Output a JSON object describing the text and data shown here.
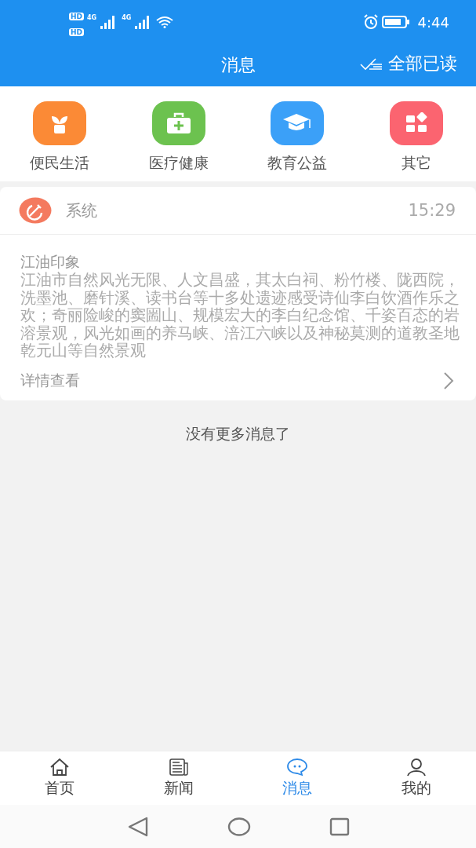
{
  "status_bar": {
    "sim_labels": [
      "HD",
      "HD"
    ],
    "network_labels": [
      "4G",
      "4G"
    ],
    "time": "4:44"
  },
  "header": {
    "title": "消息",
    "action": "全部已读"
  },
  "categories": [
    {
      "label": "便民生活",
      "kind": "plant",
      "color": "#fb8a36"
    },
    {
      "label": "医疗健康",
      "kind": "medkit",
      "color": "#6cc24f"
    },
    {
      "label": "教育公益",
      "kind": "cap",
      "color": "#3ba0f8"
    },
    {
      "label": "其它",
      "kind": "grid",
      "color": "#fb6470"
    }
  ],
  "messages": [
    {
      "sender": "系统",
      "time": "15:29",
      "title": "江油印象",
      "body": "江油市自然风光无限、人文昌盛，其太白祠、粉竹楼、陇西院，洗墨池、磨针溪、读书台等十多处遗迹感受诗仙李白饮酒作乐之欢；奇丽险峻的窦圌山、规模宏大的李白纪念馆、千姿百态的岩溶景观，风光如画的养马峡、涪江六峡以及神秘莫测的道教圣地乾元山等自然景观",
      "link": "详情查看"
    }
  ],
  "end_note": "没有更多消息了",
  "tabs": [
    {
      "label": "首页",
      "kind": "home",
      "selected": false
    },
    {
      "label": "新闻",
      "kind": "news",
      "selected": false
    },
    {
      "label": "消息",
      "kind": "chat",
      "selected": true
    },
    {
      "label": "我的",
      "kind": "person",
      "selected": false
    }
  ]
}
